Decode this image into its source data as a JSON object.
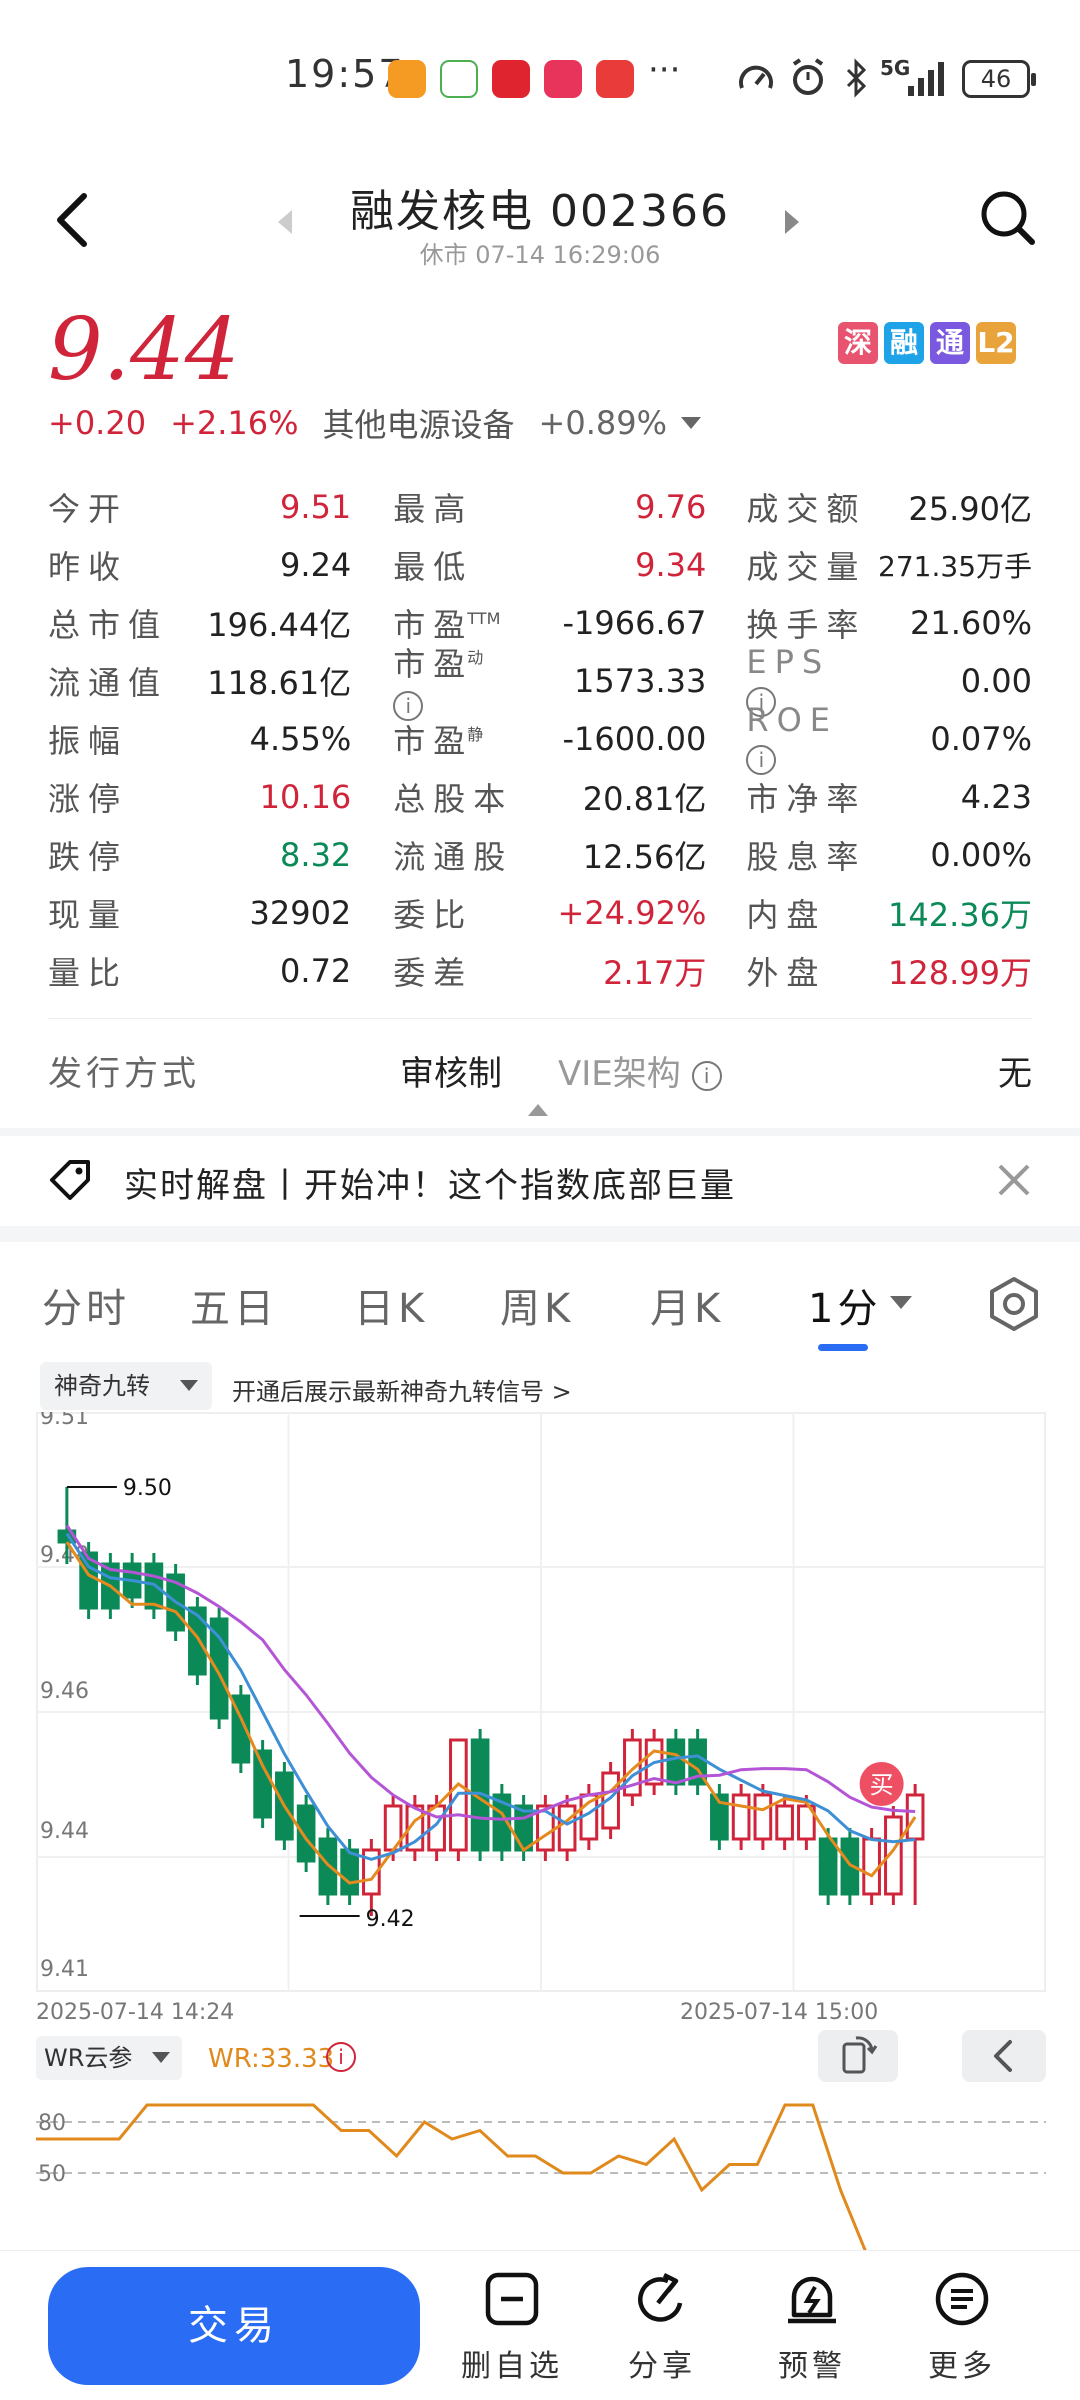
{
  "status_bar": {
    "time": "19:57",
    "network": "5G",
    "battery": "46"
  },
  "header": {
    "title": "融发核电 002366",
    "subtitle": "休市 07-14 16:29:06"
  },
  "price": {
    "current": "9.44",
    "change": "+0.20",
    "change_pct": "+2.16%",
    "sector": "其他电源设备",
    "sector_change": "+0.89%",
    "badges": [
      {
        "label": "深",
        "color": "#e8546f"
      },
      {
        "label": "融",
        "color": "#1ea2e8"
      },
      {
        "label": "通",
        "color": "#7b58e0"
      },
      {
        "label": "L2",
        "color": "#e8a33a"
      }
    ]
  },
  "quote": {
    "rows": [
      {
        "l1": "今开",
        "v1": "9.51",
        "l2": "最高",
        "v2": "9.76",
        "l3": "成交额",
        "v3": "25.90亿"
      },
      {
        "l1": "昨收",
        "v1": "9.24",
        "l2": "最低",
        "v2": "9.34",
        "l3": "成交量",
        "v3": "271.35万手"
      },
      {
        "l1": "总市值",
        "v1": "196.44亿",
        "l2": "市盈",
        "l2_sup": "TTM",
        "v2": "-1966.67",
        "l3": "换手率",
        "v3": "21.60%"
      },
      {
        "l1": "流通值",
        "v1": "118.61亿",
        "l2": "市盈",
        "l2_sup": "动",
        "v2": "1573.33",
        "l3": "EPS",
        "v3": "0.00"
      },
      {
        "l1": "振幅",
        "v1": "4.55%",
        "l2": "市盈",
        "l2_sup": "静",
        "v2": "-1600.00",
        "l3": "ROE",
        "v3": "0.07%"
      },
      {
        "l1": "涨停",
        "v1": "10.16",
        "l2": "总股本",
        "v2": "20.81亿",
        "l3": "市净率",
        "v3": "4.23"
      },
      {
        "l1": "跌停",
        "v1": "8.32",
        "l2": "流通股",
        "v2": "12.56亿",
        "l3": "股息率",
        "v3": "0.00%"
      },
      {
        "l1": "现量",
        "v1": "32902",
        "l2": "委比",
        "v2": "+24.92%",
        "l3": "内盘",
        "v3": "142.36万"
      },
      {
        "l1": "量比",
        "v1": "0.72",
        "l2": "委差",
        "v2": "2.17万",
        "l3": "外盘",
        "v3": "128.99万"
      }
    ],
    "info_glyph": "i"
  },
  "issue": {
    "label": "发行方式",
    "value": "审核制",
    "label2": "VIE架构",
    "value2": "无"
  },
  "banner": {
    "text": "实时解盘丨开始冲！这个指数底部巨量"
  },
  "tabs": [
    "分时",
    "五日",
    "日K",
    "周K",
    "月K",
    "1分"
  ],
  "indicator": {
    "name": "神奇九转",
    "tip": "开通后展示最新神奇九转信号 >"
  },
  "chart_data": {
    "type": "candlestick",
    "y_ticks": [
      "9.51",
      "9.48",
      "9.46",
      "9.44",
      "9.41"
    ],
    "ylim": [
      9.41,
      9.51
    ],
    "x_labels": [
      "2025-07-14 14:24",
      "2025-07-14 15:00"
    ],
    "annotations": [
      "9.50",
      "9.42"
    ],
    "buy_marker": "买",
    "candles": [
      {
        "o": 9.492,
        "c": 9.49,
        "h": 9.5,
        "l": 9.486
      },
      {
        "o": 9.488,
        "c": 9.478,
        "h": 9.49,
        "l": 9.476
      },
      {
        "o": 9.486,
        "c": 9.478,
        "h": 9.488,
        "l": 9.476
      },
      {
        "o": 9.486,
        "c": 9.48,
        "h": 9.488,
        "l": 9.478
      },
      {
        "o": 9.486,
        "c": 9.478,
        "h": 9.488,
        "l": 9.476
      },
      {
        "o": 9.484,
        "c": 9.474,
        "h": 9.486,
        "l": 9.472
      },
      {
        "o": 9.478,
        "c": 9.466,
        "h": 9.48,
        "l": 9.464
      },
      {
        "o": 9.476,
        "c": 9.458,
        "h": 9.478,
        "l": 9.456
      },
      {
        "o": 9.462,
        "c": 9.45,
        "h": 9.464,
        "l": 9.448
      },
      {
        "o": 9.452,
        "c": 9.44,
        "h": 9.454,
        "l": 9.438
      },
      {
        "o": 9.448,
        "c": 9.436,
        "h": 9.45,
        "l": 9.434
      },
      {
        "o": 9.442,
        "c": 9.432,
        "h": 9.444,
        "l": 9.43
      },
      {
        "o": 9.436,
        "c": 9.426,
        "h": 9.438,
        "l": 9.424
      },
      {
        "o": 9.434,
        "c": 9.426,
        "h": 9.436,
        "l": 9.424
      },
      {
        "o": 9.426,
        "c": 9.434,
        "h": 9.436,
        "l": 9.422
      },
      {
        "o": 9.434,
        "c": 9.442,
        "h": 9.444,
        "l": 9.432
      },
      {
        "o": 9.434,
        "c": 9.442,
        "h": 9.444,
        "l": 9.432
      },
      {
        "o": 9.434,
        "c": 9.442,
        "h": 9.444,
        "l": 9.432
      },
      {
        "o": 9.434,
        "c": 9.454,
        "h": 9.454,
        "l": 9.432
      },
      {
        "o": 9.454,
        "c": 9.434,
        "h": 9.456,
        "l": 9.432
      },
      {
        "o": 9.444,
        "c": 9.434,
        "h": 9.446,
        "l": 9.432
      },
      {
        "o": 9.442,
        "c": 9.434,
        "h": 9.444,
        "l": 9.432
      },
      {
        "o": 9.434,
        "c": 9.442,
        "h": 9.444,
        "l": 9.432
      },
      {
        "o": 9.434,
        "c": 9.442,
        "h": 9.444,
        "l": 9.432
      },
      {
        "o": 9.436,
        "c": 9.444,
        "h": 9.446,
        "l": 9.434
      },
      {
        "o": 9.438,
        "c": 9.448,
        "h": 9.45,
        "l": 9.436
      },
      {
        "o": 9.444,
        "c": 9.454,
        "h": 9.456,
        "l": 9.442
      },
      {
        "o": 9.446,
        "c": 9.454,
        "h": 9.456,
        "l": 9.444
      },
      {
        "o": 9.454,
        "c": 9.446,
        "h": 9.456,
        "l": 9.444
      },
      {
        "o": 9.454,
        "c": 9.446,
        "h": 9.456,
        "l": 9.444
      },
      {
        "o": 9.444,
        "c": 9.436,
        "h": 9.446,
        "l": 9.434
      },
      {
        "o": 9.436,
        "c": 9.444,
        "h": 9.446,
        "l": 9.434
      },
      {
        "o": 9.436,
        "c": 9.444,
        "h": 9.446,
        "l": 9.434
      },
      {
        "o": 9.436,
        "c": 9.442,
        "h": 9.444,
        "l": 9.434
      },
      {
        "o": 9.436,
        "c": 9.442,
        "h": 9.444,
        "l": 9.434
      },
      {
        "o": 9.436,
        "c": 9.426,
        "h": 9.438,
        "l": 9.424
      },
      {
        "o": 9.436,
        "c": 9.426,
        "h": 9.438,
        "l": 9.424
      },
      {
        "o": 9.426,
        "c": 9.436,
        "h": 9.438,
        "l": 9.424
      },
      {
        "o": 9.426,
        "c": 9.44,
        "h": 9.442,
        "l": 9.424
      },
      {
        "o": 9.436,
        "c": 9.444,
        "h": 9.446,
        "l": 9.424
      }
    ],
    "ma_colors": [
      "#e58a1f",
      "#3d8fd6",
      "#b455d6"
    ],
    "up_color": "#d0243a",
    "down_color": "#0b8a57"
  },
  "wr": {
    "name": "WR云参",
    "value": "WR:33.33",
    "y_labels": [
      "80",
      "50"
    ],
    "series": [
      70,
      70,
      70,
      70,
      90,
      90,
      90,
      90,
      90,
      90,
      90,
      75,
      75,
      60,
      80,
      70,
      75,
      60,
      60,
      50,
      50,
      60,
      55,
      70,
      40,
      55,
      55,
      90,
      90,
      40,
      0,
      0
    ]
  },
  "bottom": {
    "trade": "交易",
    "items": [
      "删自选",
      "分享",
      "预警",
      "更多"
    ]
  }
}
